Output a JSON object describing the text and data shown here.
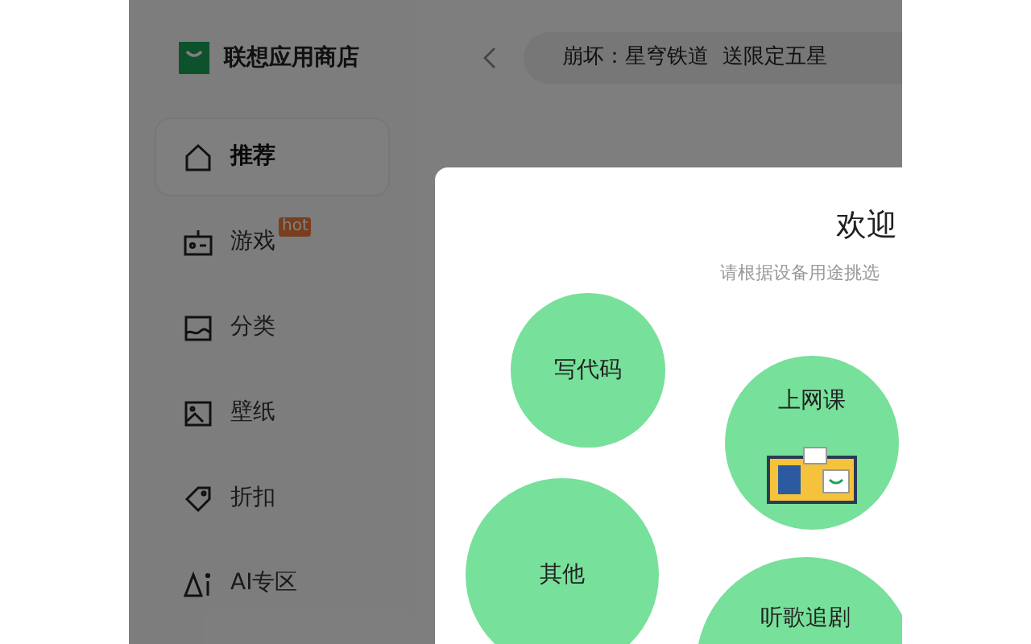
{
  "app": {
    "name": "联想应用商店"
  },
  "sidebar": {
    "items": [
      {
        "kind": "home",
        "label": "推荐",
        "selected": true
      },
      {
        "kind": "game",
        "label": "游戏",
        "selected": false,
        "badge": "hot"
      },
      {
        "kind": "category",
        "label": "分类",
        "selected": false
      },
      {
        "kind": "wallpaper",
        "label": "壁纸",
        "selected": false
      },
      {
        "kind": "discount",
        "label": "折扣",
        "selected": false
      },
      {
        "kind": "ai",
        "label": "AI专区",
        "selected": false
      }
    ]
  },
  "search": {
    "value": "崩坏：星穹铁道  送限定五星"
  },
  "dialog": {
    "title": "欢迎",
    "subtitle": "请根据设备用途挑选",
    "options": [
      {
        "label": "写代码",
        "illustrated": false
      },
      {
        "label": "上网课",
        "illustrated": true
      },
      {
        "label": "其他",
        "illustrated": false
      },
      {
        "label": "听歌追剧",
        "illustrated": false
      }
    ]
  }
}
